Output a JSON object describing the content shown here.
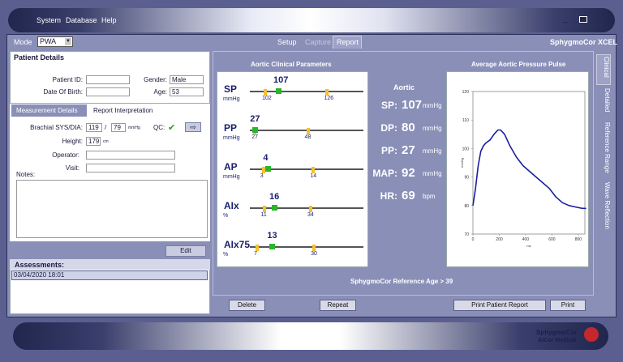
{
  "menu": {
    "system": "System",
    "database": "Database",
    "help": "Help"
  },
  "window": {
    "minimize": "_"
  },
  "mode": {
    "label": "Mode",
    "value": "PWA"
  },
  "top_tabs": [
    "Setup",
    "Capture",
    "Report"
  ],
  "app_name": "SphygmoCor XCEL",
  "patient": {
    "header": "Patient Details",
    "id_label": "Patient ID:",
    "id_value": "",
    "gender_label": "Gender:",
    "gender_value": "Male",
    "dob_label": "Date Of Birth:",
    "dob_value": "",
    "age_label": "Age:",
    "age_value": "53"
  },
  "measurement": {
    "tab1": "Measurement Details",
    "tab2": "Report Interpretation",
    "bp_label": "Brachial SYS/DIA:",
    "sys": "119",
    "slash": "/",
    "dia": "79",
    "bp_unit": "mmHg",
    "qc_label": "QC:",
    "qc_mark": "✔",
    "height_label": "Height:",
    "height": "179",
    "height_unit": "cm",
    "operator_label": "Operator:",
    "visit_label": "Visit:",
    "notes_label": "Notes:"
  },
  "edit_label": "Edit",
  "assessments": {
    "header": "Assessments:",
    "items": [
      "03/04/2020 18:01"
    ]
  },
  "clinical": {
    "title": "Aortic Clinical Parameters",
    "params": [
      {
        "name": "SP",
        "unit": "mmHg",
        "value": 107,
        "low": 102,
        "high": 126,
        "min": 96,
        "max": 140
      },
      {
        "name": "PP",
        "unit": "mmHg",
        "value": 27,
        "low": 27,
        "high": 48,
        "min": 25,
        "max": 70
      },
      {
        "name": "AP",
        "unit": "mmHg",
        "value": 4,
        "low": 3,
        "high": 14,
        "min": 0,
        "max": 25
      },
      {
        "name": "AIx",
        "unit": "%",
        "value": 16,
        "low": 11,
        "high": 34,
        "min": 4,
        "max": 60
      },
      {
        "name": "AIx75",
        "unit": "%",
        "value": 13,
        "low": 7,
        "high": 30,
        "min": 4,
        "max": 50
      }
    ]
  },
  "aortic": {
    "title": "Aortic",
    "rows": [
      {
        "label": "SP:",
        "value": "107",
        "unit": "mmHg"
      },
      {
        "label": "DP:",
        "value": "80",
        "unit": "mmHg"
      },
      {
        "label": "PP:",
        "value": "27",
        "unit": "mmHg"
      },
      {
        "label": "MAP:",
        "value": "92",
        "unit": "mmHg"
      },
      {
        "label": "HR:",
        "value": "69",
        "unit": "bpm"
      }
    ]
  },
  "chart_data": {
    "type": "line",
    "title": "Average Aortic Pressure Pulse",
    "xlabel": "ms",
    "ylabel": "mmHg",
    "xlim": [
      0,
      850
    ],
    "ylim": [
      70,
      120
    ],
    "xticks": [
      "0",
      "200",
      "400",
      "600",
      "800"
    ],
    "yticks": [
      "70",
      "80",
      "90",
      "100",
      "110",
      "120"
    ],
    "series": [
      {
        "x": [
          0,
          20,
          40,
          60,
          80,
          100,
          130,
          160,
          190,
          210,
          240,
          280,
          330,
          380,
          430,
          480,
          530,
          580,
          630,
          680,
          730,
          780,
          830,
          860
        ],
        "y": [
          80,
          86,
          94,
          99,
          101,
          102,
          103,
          105,
          106.5,
          106.5,
          105,
          101,
          97,
          94,
          92,
          90,
          88,
          86,
          83,
          81,
          80,
          79.5,
          79,
          79
        ],
        "color": "#1a1f9e"
      }
    ]
  },
  "reference_age": "SphygmoCor Reference Age > 39",
  "buttons": {
    "delete": "Delete",
    "repeat": "Repeat",
    "print_report": "Print Patient Report",
    "print": "Print"
  },
  "side_tabs": [
    "Clinical",
    "Detailed",
    "Reference Range",
    "Wave Reflection"
  ],
  "footer": {
    "logo1": "SphygmoCor",
    "logo2": "AtCor Medical"
  }
}
